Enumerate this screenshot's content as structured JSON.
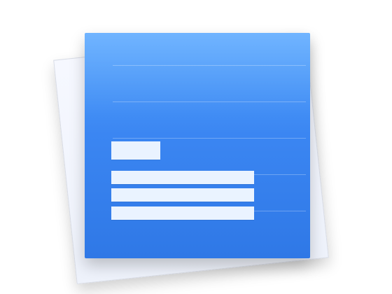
{
  "app_icon": {
    "kind": "document-icon",
    "colors": {
      "blue_top": "#55a6ff",
      "blue_bottom": "#2f78e6",
      "paper": "#f6f8ff",
      "paper_edge": "#d8dce6",
      "text_blocks": "#eaf3ff"
    }
  }
}
